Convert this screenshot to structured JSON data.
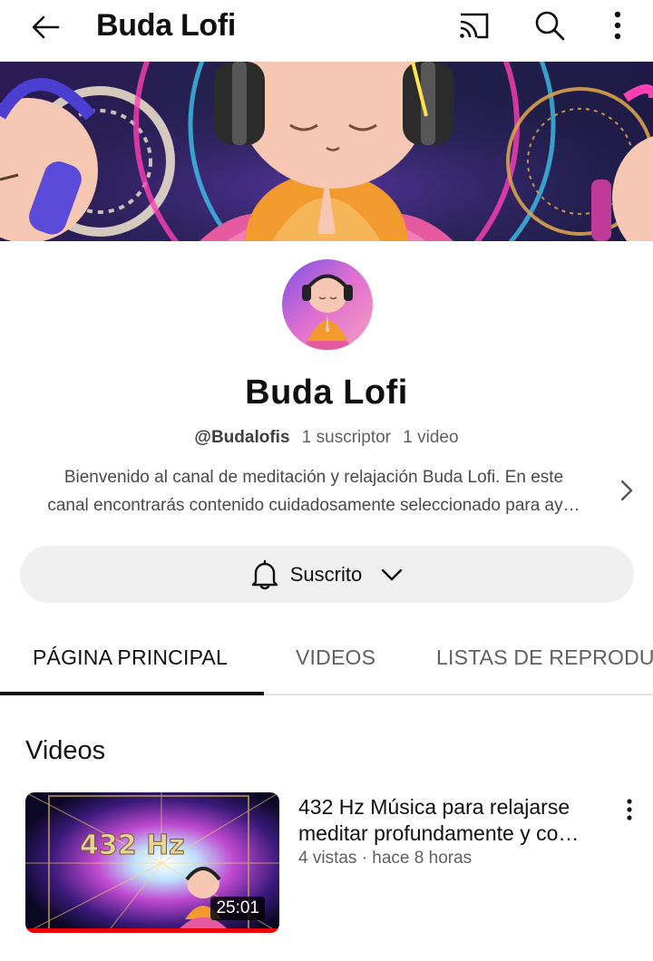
{
  "header": {
    "title": "Buda Lofi",
    "icons": [
      "back-arrow-icon",
      "cast-icon",
      "search-icon",
      "more-vert-icon"
    ]
  },
  "channel": {
    "name": "Buda Lofi",
    "handle": "@Budalofis",
    "subscribers": "1 suscriptor",
    "videos_count": "1 video",
    "description_line1": "Bienvenido al canal de meditación y relajación Buda Lofi. En este",
    "description_line2": "canal encontrarás contenido cuidadosamente seleccionado para ay…"
  },
  "subscribe_button": {
    "label": "Suscrito"
  },
  "tabs": [
    {
      "label": "PÁGINA PRINCIPAL",
      "active": true
    },
    {
      "label": "VIDEOS",
      "active": false
    },
    {
      "label": "LISTAS DE REPRODUCCIÓN",
      "active": false
    }
  ],
  "section": {
    "title": "Videos"
  },
  "videos": [
    {
      "title_line1": "432 Hz Música para relajarse",
      "title_line2": "meditar profundamente y co…",
      "meta": "4 vistas · hace 8 horas",
      "duration": "25:01",
      "thumb_text": "432 Hz"
    }
  ],
  "colors": {
    "accent_red": "#e00000",
    "muted_text": "#606060",
    "button_bg": "#f0f0f0"
  }
}
